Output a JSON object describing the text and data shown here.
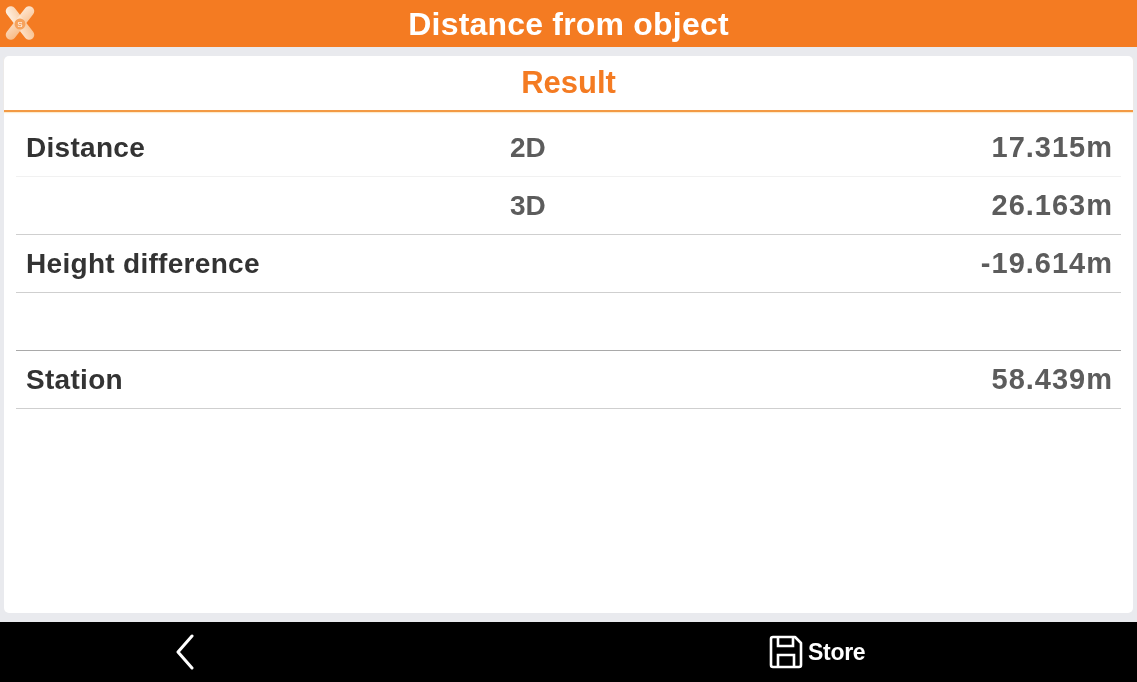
{
  "header": {
    "logo_letter": "S",
    "title": "Distance from object"
  },
  "result": {
    "title": "Result",
    "rows": [
      {
        "kind": "value",
        "label": "Distance",
        "sub": "2D",
        "value": "17.315m"
      },
      {
        "kind": "value",
        "sub": "3D",
        "value": "26.163m"
      },
      {
        "kind": "value",
        "label": "Height difference",
        "value": "-19.614m"
      },
      {
        "kind": "blank"
      },
      {
        "kind": "value",
        "label": "Station",
        "value": "58.439m"
      }
    ]
  },
  "footer": {
    "buttons": [
      {
        "kind": "back"
      },
      {
        "kind": "store",
        "label": "Store"
      }
    ]
  }
}
